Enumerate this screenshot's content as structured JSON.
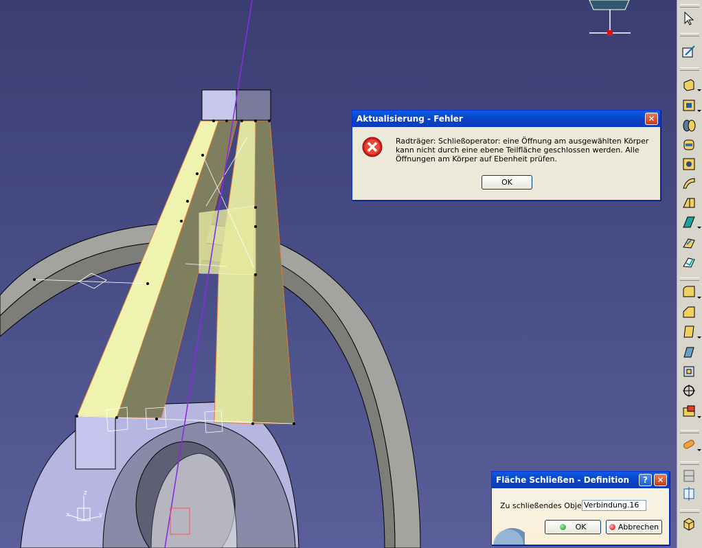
{
  "error_dialog": {
    "title": "Aktualisierung - Fehler",
    "close_glyph": "✕",
    "message": "Radträger: Schließoperator: eine Öffnung am ausgewählten Körper kann nicht durch eine ebene Teilfläche geschlossen werden. Alle Öffnungen am Körper auf Ebenheit prüfen.",
    "ok_label": "OK",
    "icon": "error-icon"
  },
  "definition_dialog": {
    "title": "Fläche Schließen - Definition",
    "help_glyph": "?",
    "close_glyph": "✕",
    "object_label": "Zu schließendes Objekt:",
    "object_value": "Verbindung.16",
    "ok_label": "OK",
    "cancel_label": "Abbrechen"
  },
  "compass_axes": {
    "z": "z",
    "y": "y",
    "x": "x"
  },
  "toolbar": {
    "tools": [
      "select-arrow-icon",
      "sketch-icon",
      "pad-icon",
      "pocket-icon",
      "shaft-icon",
      "groove-icon",
      "hole-icon",
      "rib-icon",
      "slot-icon",
      "stiffener-icon",
      "loft-icon",
      "remove-loft-icon",
      "fillet-icon",
      "chamfer-icon",
      "draft-icon",
      "shell-icon",
      "thickness-icon",
      "thread-icon",
      "boolean-icon",
      "measure-icon",
      "material-icon",
      "group-icon",
      "axis-icon",
      "cube-icon"
    ]
  },
  "colors": {
    "viewport": "#4a4f88",
    "part_light": "#eef3b0",
    "part_dark": "#7d7f5e",
    "hub": "#c8c8ec",
    "wheel": "#9a9a98",
    "title_bar": "#0a4fd6"
  }
}
